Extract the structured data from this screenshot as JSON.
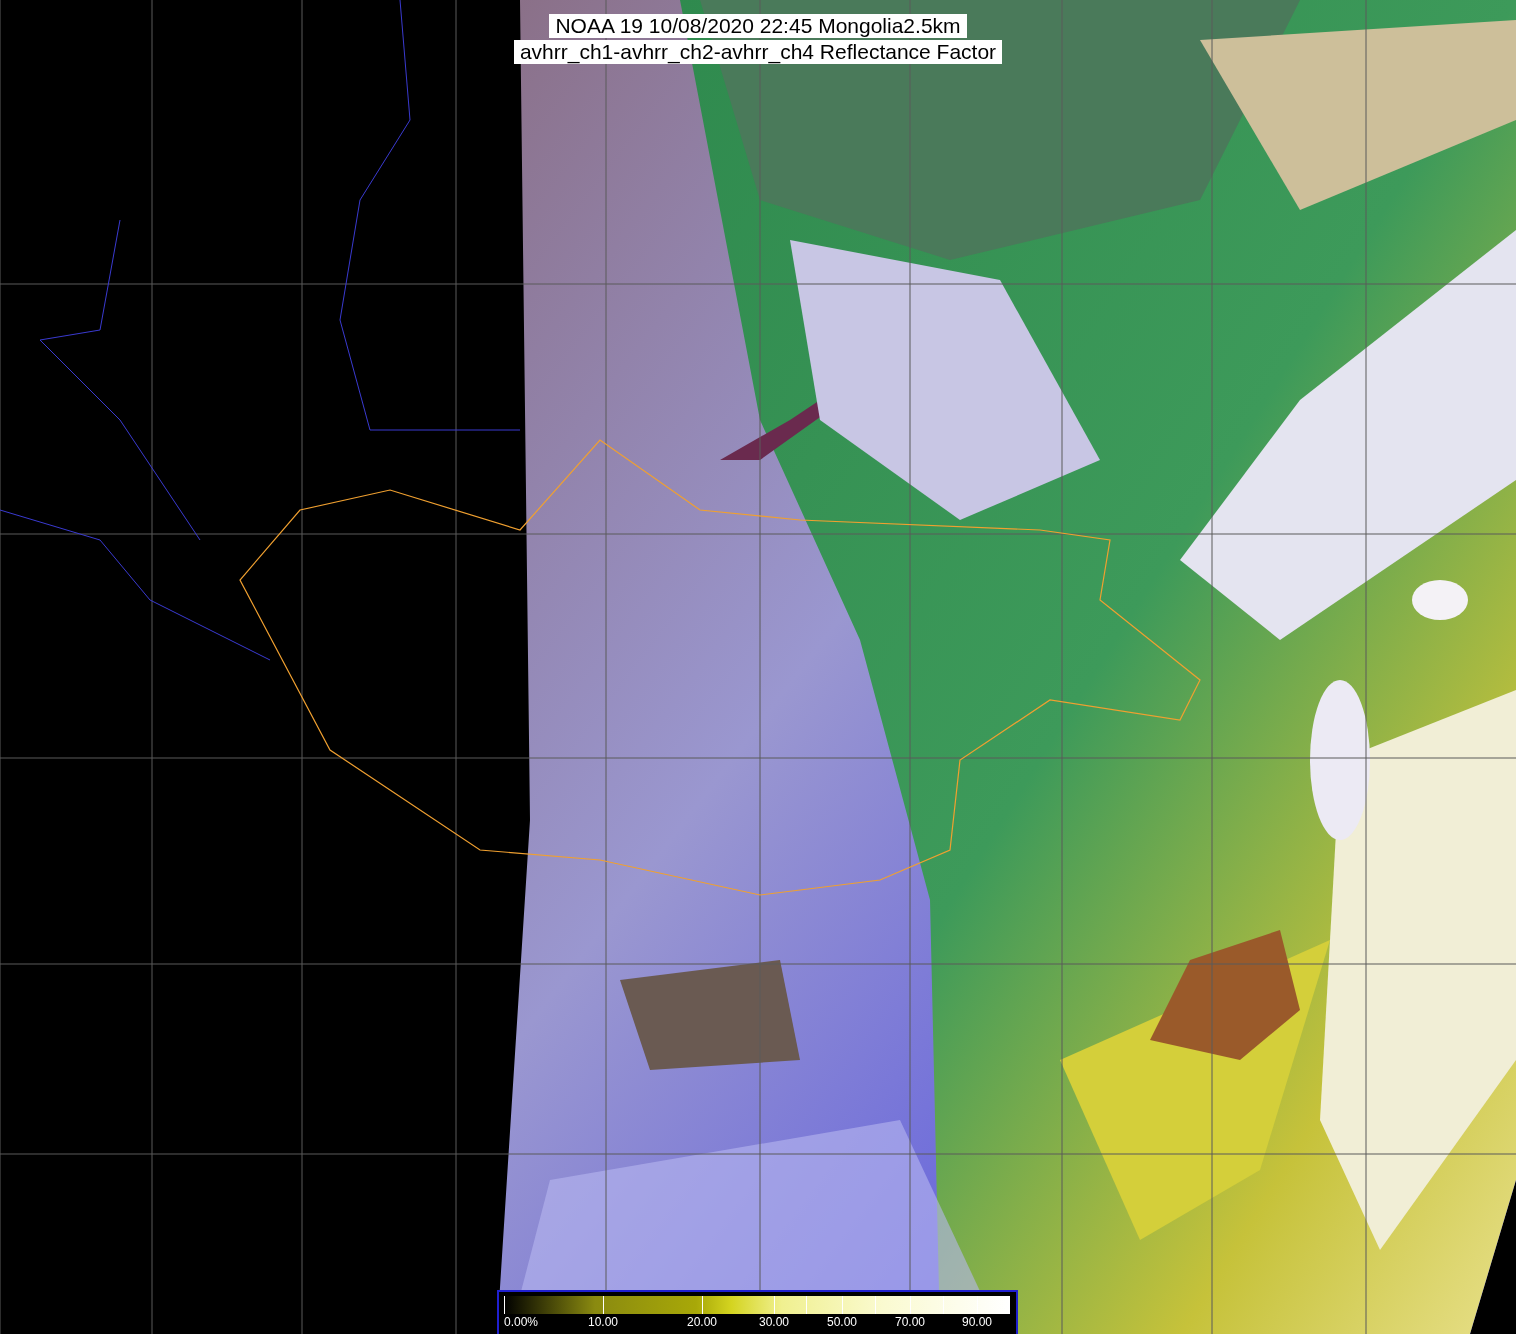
{
  "title_lines": [
    "NOAA 19 10/08/2020 22:45 Mongolia2.5km",
    "avhrr_ch1-avhrr_ch2-avhrr_ch4 Reflectance Factor"
  ],
  "colorbar": {
    "labels": [
      "0.00%",
      "10.00",
      "20.00",
      "30.00",
      "50.00",
      "70.00",
      "90.00"
    ]
  }
}
